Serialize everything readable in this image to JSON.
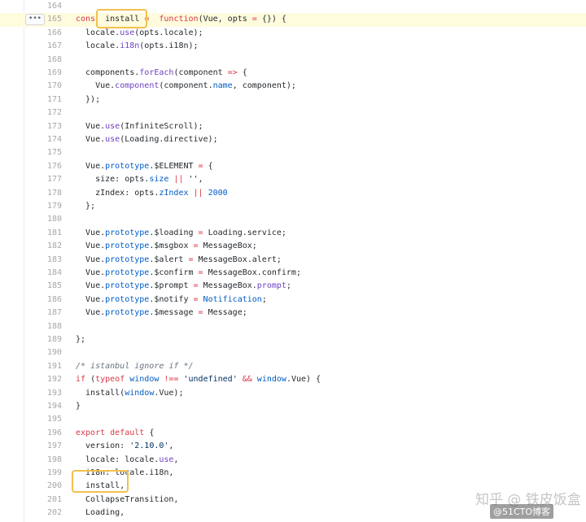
{
  "more_button": "•••",
  "lines": [
    {
      "n": "164",
      "t": []
    },
    {
      "n": "165",
      "hl": true,
      "t": [
        [
          "kw",
          "cons"
        ],
        [
          "",
          "  install "
        ],
        [
          "op",
          "="
        ],
        [
          "",
          "",
          " "
        ],
        [
          "kw",
          " function"
        ],
        [
          "",
          "(Vue, opts "
        ],
        [
          "op",
          "="
        ],
        [
          "",
          " {}) {"
        ]
      ]
    },
    {
      "n": "166",
      "t": [
        [
          "",
          "  locale."
        ],
        [
          "fn",
          "use"
        ],
        [
          "",
          "(opts.locale);"
        ]
      ]
    },
    {
      "n": "167",
      "t": [
        [
          "",
          "  locale."
        ],
        [
          "fn",
          "i18n"
        ],
        [
          "",
          "(opts.i18n);"
        ]
      ]
    },
    {
      "n": "168",
      "t": []
    },
    {
      "n": "169",
      "t": [
        [
          "",
          "  components."
        ],
        [
          "fn",
          "forEach"
        ],
        [
          "",
          "(component "
        ],
        [
          "op",
          "=>"
        ],
        [
          "",
          " {"
        ]
      ]
    },
    {
      "n": "170",
      "t": [
        [
          "",
          "    Vue."
        ],
        [
          "fn",
          "component"
        ],
        [
          "",
          "(component."
        ],
        [
          "pr",
          "name"
        ],
        [
          "",
          ", component);"
        ]
      ]
    },
    {
      "n": "171",
      "t": [
        [
          "",
          "  });"
        ]
      ]
    },
    {
      "n": "172",
      "t": []
    },
    {
      "n": "173",
      "t": [
        [
          "",
          "  Vue."
        ],
        [
          "fn",
          "use"
        ],
        [
          "",
          "(InfiniteScroll);"
        ]
      ]
    },
    {
      "n": "174",
      "t": [
        [
          "",
          "  Vue."
        ],
        [
          "fn",
          "use"
        ],
        [
          "",
          "(Loading.directive);"
        ]
      ]
    },
    {
      "n": "175",
      "t": []
    },
    {
      "n": "176",
      "t": [
        [
          "",
          "  Vue."
        ],
        [
          "pr",
          "prototype"
        ],
        [
          "",
          ".$ELEMENT "
        ],
        [
          "op",
          "="
        ],
        [
          "",
          " {"
        ]
      ]
    },
    {
      "n": "177",
      "t": [
        [
          "",
          "    size: opts."
        ],
        [
          "pr",
          "size"
        ],
        [
          "op",
          " ||"
        ],
        [
          "",
          " '',"
        ]
      ]
    },
    {
      "n": "178",
      "t": [
        [
          "",
          "    zIndex: opts."
        ],
        [
          "pr",
          "zIndex"
        ],
        [
          "op",
          " ||"
        ],
        [
          "pr",
          " 2000"
        ]
      ]
    },
    {
      "n": "179",
      "t": [
        [
          "",
          "  };"
        ]
      ]
    },
    {
      "n": "180",
      "t": []
    },
    {
      "n": "181",
      "t": [
        [
          "",
          "  Vue."
        ],
        [
          "pr",
          "prototype"
        ],
        [
          "",
          ".$loading "
        ],
        [
          "op",
          "="
        ],
        [
          "",
          " Loading.service;"
        ]
      ]
    },
    {
      "n": "182",
      "t": [
        [
          "",
          "  Vue."
        ],
        [
          "pr",
          "prototype"
        ],
        [
          "",
          ".$msgbox "
        ],
        [
          "op",
          "="
        ],
        [
          "",
          " MessageBox;"
        ]
      ]
    },
    {
      "n": "183",
      "t": [
        [
          "",
          "  Vue."
        ],
        [
          "pr",
          "prototype"
        ],
        [
          "",
          ".$alert "
        ],
        [
          "op",
          "="
        ],
        [
          "",
          " MessageBox.alert;"
        ]
      ]
    },
    {
      "n": "184",
      "t": [
        [
          "",
          "  Vue."
        ],
        [
          "pr",
          "prototype"
        ],
        [
          "",
          ".$confirm "
        ],
        [
          "op",
          "="
        ],
        [
          "",
          " MessageBox.confirm;"
        ]
      ]
    },
    {
      "n": "185",
      "t": [
        [
          "",
          "  Vue."
        ],
        [
          "pr",
          "prototype"
        ],
        [
          "",
          ".$prompt "
        ],
        [
          "op",
          "="
        ],
        [
          "",
          " MessageBox."
        ],
        [
          "fn",
          "prompt"
        ],
        [
          "",
          ";"
        ]
      ]
    },
    {
      "n": "186",
      "t": [
        [
          "",
          "  Vue."
        ],
        [
          "pr",
          "prototype"
        ],
        [
          "",
          ".$notify "
        ],
        [
          "op",
          "="
        ],
        [
          "pr",
          " Notification"
        ],
        [
          "",
          ";"
        ]
      ]
    },
    {
      "n": "187",
      "t": [
        [
          "",
          "  Vue."
        ],
        [
          "pr",
          "prototype"
        ],
        [
          "",
          ".$message "
        ],
        [
          "op",
          "="
        ],
        [
          "",
          " Message;"
        ]
      ]
    },
    {
      "n": "188",
      "t": []
    },
    {
      "n": "189",
      "t": [
        [
          "",
          "};"
        ]
      ]
    },
    {
      "n": "190",
      "t": []
    },
    {
      "n": "191",
      "t": [
        [
          "cm",
          "/* istanbul ignore if */"
        ]
      ]
    },
    {
      "n": "192",
      "t": [
        [
          "kw",
          "if"
        ],
        [
          "",
          " ("
        ],
        [
          "kw",
          "typeof"
        ],
        [
          "pr",
          " window"
        ],
        [
          "op",
          " !=="
        ],
        [
          "st",
          " 'undefined'"
        ],
        [
          "op",
          " &&"
        ],
        [
          "pr",
          " window"
        ],
        [
          "",
          ".Vue) {"
        ]
      ]
    },
    {
      "n": "193",
      "t": [
        [
          "",
          "  install("
        ],
        [
          "pr",
          "window"
        ],
        [
          "",
          ".Vue);"
        ]
      ]
    },
    {
      "n": "194",
      "t": [
        [
          "",
          "}"
        ]
      ]
    },
    {
      "n": "195",
      "t": []
    },
    {
      "n": "196",
      "t": [
        [
          "kw",
          "export"
        ],
        [
          "kw",
          " default"
        ],
        [
          "",
          " {"
        ]
      ]
    },
    {
      "n": "197",
      "t": [
        [
          "",
          "  version: "
        ],
        [
          "st",
          "'2.10.0'"
        ],
        [
          "",
          ","
        ]
      ]
    },
    {
      "n": "198",
      "t": [
        [
          "",
          "  locale: locale."
        ],
        [
          "fn",
          "use"
        ],
        [
          "",
          ","
        ]
      ]
    },
    {
      "n": "199",
      "t": [
        [
          "",
          "  i18n: locale.i18n,"
        ]
      ]
    },
    {
      "n": "200",
      "t": [
        [
          "",
          "  install,"
        ]
      ]
    },
    {
      "n": "201",
      "t": [
        [
          "",
          "  CollapseTransition,"
        ]
      ]
    },
    {
      "n": "202",
      "t": [
        [
          "",
          "  Loading,"
        ]
      ]
    }
  ],
  "watermark": {
    "zhihu": "知乎 @ 铁皮饭盒",
    "blog": "@51CTO博客"
  },
  "colors": {
    "callout": "#f2c14e",
    "highlight_row": "#fffbdd",
    "keyword": "#d73a49",
    "function": "#6f42c1",
    "property": "#005cc5",
    "string": "#032f62"
  }
}
